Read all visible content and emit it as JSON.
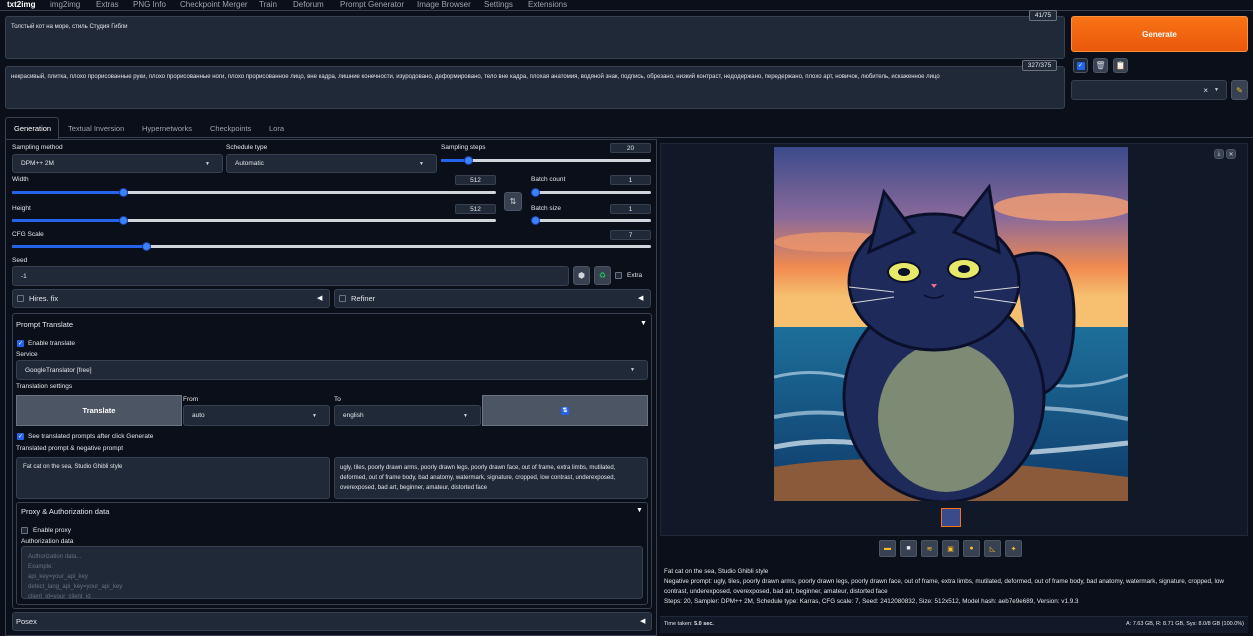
{
  "top_tabs": [
    "txt2img",
    "img2img",
    "Extras",
    "PNG Info",
    "Checkpoint Merger",
    "Train",
    "Deforum",
    "Prompt Generator",
    "Image Browser",
    "Settings",
    "Extensions"
  ],
  "prompt": {
    "text": "Толстый кот на море, стиль Студия Гибли",
    "counter": "41/75"
  },
  "negative_prompt": {
    "text": "некрасивый, плитка, плохо прорисованные руки, плохо прорисованные ноги, плохо прорисованное лицо, вне кадра, лишние конечности, изуродовано, деформировано, тело вне кадра, плохая анатомия, водяной знак, подпись, обрезано, низкий контраст, недодержано, передержано, плохо арт, новичок, любитель, искаженное лицо",
    "counter": "327/375"
  },
  "generate_label": "Generate",
  "style_select_clear": "×",
  "gen_tabs": [
    "Generation",
    "Textual Inversion",
    "Hypernetworks",
    "Checkpoints",
    "Lora"
  ],
  "sampling": {
    "method_label": "Sampling method",
    "method": "DPM++ 2M",
    "schedule_label": "Schedule type",
    "schedule": "Automatic",
    "steps_label": "Sampling steps",
    "steps": "20"
  },
  "width": {
    "label": "Width",
    "value": "512",
    "fraction": 0.23
  },
  "height": {
    "label": "Height",
    "value": "512",
    "fraction": 0.23
  },
  "batch_count": {
    "label": "Batch count",
    "value": "1",
    "fraction": 0.0
  },
  "batch_size": {
    "label": "Batch size",
    "value": "1",
    "fraction": 0.0
  },
  "cfg": {
    "label": "CFG Scale",
    "value": "7",
    "fraction": 0.21
  },
  "steps_fraction": 0.13,
  "seed": {
    "label": "Seed",
    "value": "-1",
    "extra_label": "Extra"
  },
  "hires_label": "Hires. fix",
  "refiner_label": "Refiner",
  "prompt_translate": {
    "title": "Prompt Translate",
    "enable_label": "Enable translate",
    "service_label": "Service",
    "service": "GoogleTranslator [free]",
    "settings_label": "Translation settings",
    "translate_button": "Translate",
    "from_label": "From",
    "from_value": "auto",
    "to_label": "To",
    "to_value": "english",
    "see_translated_label": "See translated prompts after click Generate",
    "translated_label": "Translated prompt & negative prompt",
    "translated_prompt": "Fat cat on the sea, Studio Ghibli style",
    "translated_negative": "ugly, tiles, poorly drawn arms, poorly drawn legs, poorly drawn face, out of frame, extra limbs, mutilated, deformed, out of frame body, bad anatomy, watermark, signature, cropped, low contrast, underexposed, overexposed, bad art, beginner, amateur, distorted face"
  },
  "proxy": {
    "title": "Proxy & Authorization data",
    "enable_label": "Enable proxy",
    "auth_label": "Authorization data",
    "auth_placeholder": "Authorization data...\nExample:\napi_key=your_api_key\ndetect_lang_api_key=your_api_key\nclient_id=your_client_id"
  },
  "posex_label": "Posex",
  "output_info": {
    "prompt": "Fat cat on the sea, Studio Ghibli style",
    "negative": "Negative prompt: ugly, tiles, poorly drawn arms, poorly drawn legs, poorly drawn face, out of frame, extra limbs, mutilated, deformed, out of frame body, bad anatomy, watermark, signature, cropped, low contrast, underexposed, overexposed, bad art, beginner, amateur, distorted face",
    "params": "Steps: 20, Sampler: DPM++ 2M, Schedule type: Karras, CFG scale: 7, Seed: 2412080832, Size: 512x512, Model hash: aeb7e9e689, Version: v1.9.3",
    "time_label": "Time taken:",
    "time_value": "5.0 sec.",
    "mem": "A: 7.63 GB, R: 8.71 GB, Sys: 8.0/8 GB (100.0%)"
  },
  "colors": {
    "accent": "#2563eb",
    "generate": "#f97316",
    "bg": "#0b0f19"
  }
}
